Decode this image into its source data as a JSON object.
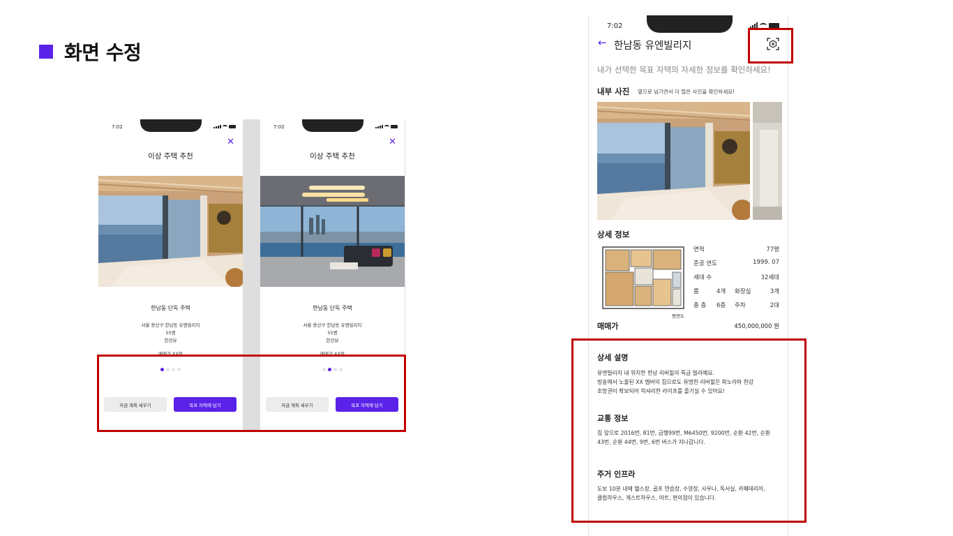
{
  "slide": {
    "title": "화면 수정"
  },
  "colors": {
    "accent": "#5a22e8",
    "highlight": "#c00000"
  },
  "left_phones": [
    {
      "time": "7:02",
      "close_icon": "✕",
      "screen_title": "이상 주택 추천",
      "house_name": "한남동 단독 주택",
      "address": "서울 용산구 한남동 유엔빌리지",
      "size": "55평",
      "view": "한강뷰",
      "price": "매매가 XX억",
      "carousel_page": 1,
      "carousel_total": 4,
      "btn_plan": "자금 계획 세우기",
      "btn_save": "목표 자택에 담기"
    },
    {
      "time": "7:02",
      "close_icon": "✕",
      "screen_title": "이상 주택 추천",
      "house_name": "한남동 단독 주택",
      "address": "서울 용산구 한남동 유엔빌리지",
      "size": "55평",
      "view": "한강뷰",
      "price": "매매가 XX억",
      "carousel_page": 2,
      "carousel_total": 4,
      "btn_plan": "자금 계획 세우기",
      "btn_save": "목표 자택에 담기"
    }
  ],
  "detail": {
    "time": "7:02",
    "back_icon": "←",
    "title": "한남동 유엔빌리지",
    "ar_icon": "ar-view-icon",
    "subtitle": "내가 선택한 목표 자택의 자세한 정보를 확인하세요!",
    "inner_photos_label": "내부 사진",
    "inner_photos_hint": "옆으로 넘기면서 더 많은 사진을 확인하세요!",
    "detail_info_label": "상세 정보",
    "floorplan_label": "평면도",
    "specs": {
      "area_label": "면적",
      "area_value": "77평",
      "built_label": "준공 연도",
      "built_value": "1999. 07",
      "households_label": "세대 수",
      "households_value": "32세대",
      "rooms_label": "룸",
      "rooms_value": "4개",
      "bath_label": "화장실",
      "bath_value": "3개",
      "floors_label": "총 층",
      "floors_value": "6층",
      "parking_label": "주차",
      "parking_value": "2대"
    },
    "sale_label": "매매가",
    "sale_value": "450,000,000 원",
    "desc_label": "상세 설명",
    "desc_lines": [
      "유엔빌리지 내 위치한 한남 리버힐의 특급 빌라예요.",
      "방송에서 노출된 XX 멤버의 집으로도 유명한 리버힐은 파노라마 한강",
      "조망권이 확보되어 럭셔리한 라이프를 즐기실 수 있어요!"
    ],
    "transit_label": "교통 정보",
    "transit_lines": [
      "집 앞으로 2016번, 81번, 급행99번, M6450번, 9200번, 순환 42번, 순환",
      "43번, 순환 44번, 9번, 6번 버스가 지나갑니다."
    ],
    "infra_label": "주거 인프라",
    "infra_lines": [
      "도보 10분 내에 헬스장, 골프 연습장, 수영장, 사우나, 독서실, 카페테리아,",
      "클럽하우스, 게스트하우스, 마트, 편의점이 있습니다."
    ]
  }
}
